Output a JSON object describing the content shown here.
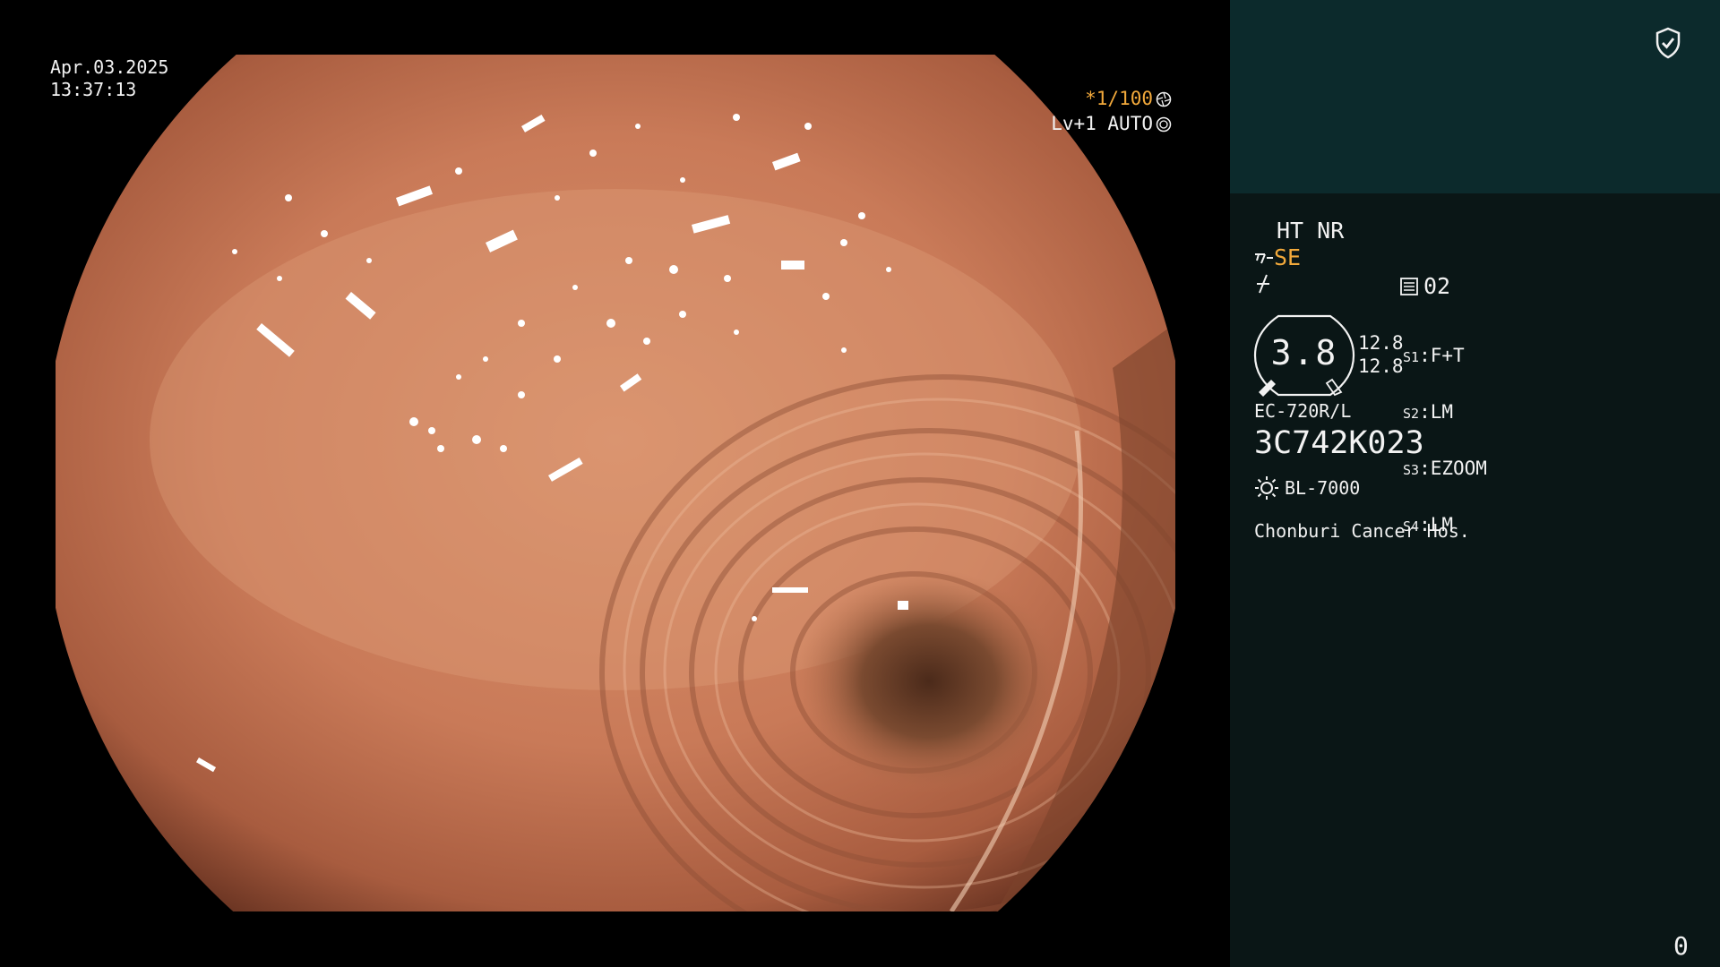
{
  "overlay": {
    "date": "Apr.03.2025",
    "time": "13:37:13",
    "shutter": "*1/100",
    "shutter_icon": "aperture-icon",
    "level": "Lv+1 AUTO",
    "level_icon": "iris-icon"
  },
  "panel": {
    "mode": "HT NR",
    "structure_enhancement": "SE",
    "memory": "02",
    "zoom": "3.8",
    "ratios": [
      "12.8",
      "12.8"
    ],
    "switches": [
      {
        "key": "S1",
        "value": "F+T"
      },
      {
        "key": "S2",
        "value": "LM"
      },
      {
        "key": "S3",
        "value": "EZOOM"
      },
      {
        "key": "S4",
        "value": "LM"
      }
    ],
    "scope_model": "EC-720R/L",
    "scope_serial": "3C742K023",
    "light_source": "BL-7000",
    "hospital": "Chonburi Cancer Hos.",
    "counter": "0"
  },
  "colors": {
    "accent": "#f2a93b",
    "panel_top": "#0c2a2c",
    "panel_body": "#0a1616",
    "tissue": "#c97a58"
  }
}
